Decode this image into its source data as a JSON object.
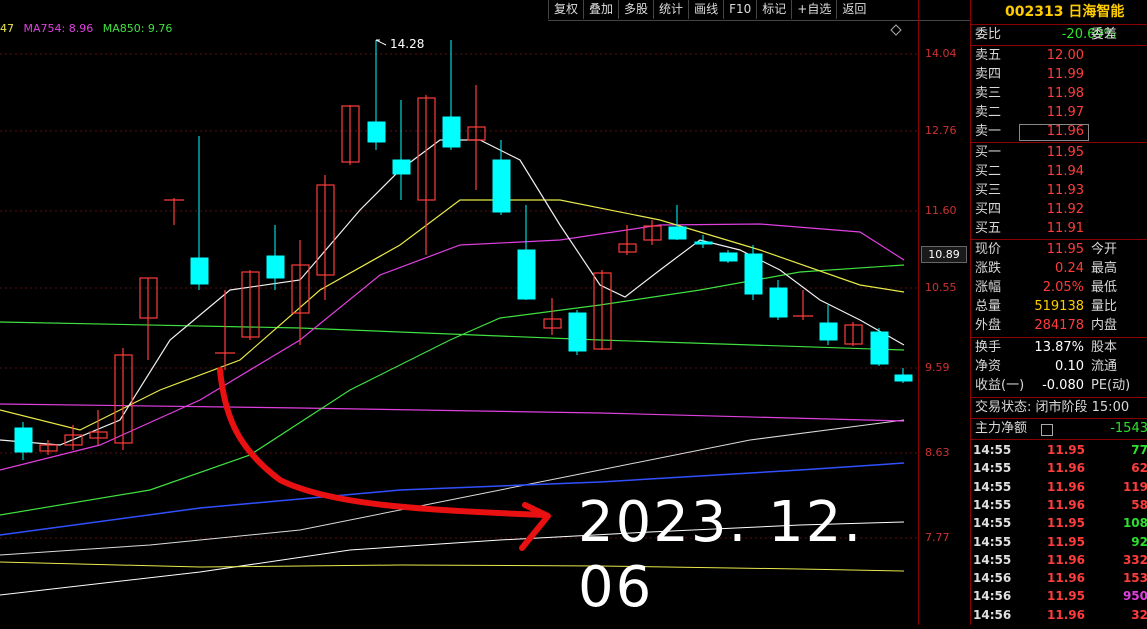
{
  "toolbar": [
    "复权",
    "叠加",
    "多股",
    "统计",
    "画线",
    "F10",
    "标记",
    "+自选",
    "返回"
  ],
  "ma_legend": [
    {
      "text": "47",
      "color": "#e8e84a"
    },
    {
      "text": "MA754: 8.96",
      "color": "#e040e0"
    },
    {
      "text": "MA850: 9.76",
      "color": "#40e040"
    }
  ],
  "price_axis": [
    "14.04",
    "12.76",
    "11.60",
    "10.55",
    "9.59",
    "8.63",
    "7.77"
  ],
  "current_price_tag": "10.89",
  "high_marker": "14.28",
  "annotation_date": "2023. 12. 06",
  "quote": {
    "code_name": "002313 日海智能",
    "weibi_label": "委比",
    "weibi_value": "-20.69%",
    "weicha_label": "委差",
    "asks": [
      {
        "label": "卖五",
        "price": "12.00"
      },
      {
        "label": "卖四",
        "price": "11.99"
      },
      {
        "label": "卖三",
        "price": "11.98"
      },
      {
        "label": "卖二",
        "price": "11.97"
      },
      {
        "label": "卖一",
        "price": "11.96"
      }
    ],
    "bids": [
      {
        "label": "买一",
        "price": "11.95"
      },
      {
        "label": "买二",
        "price": "11.94"
      },
      {
        "label": "买三",
        "price": "11.93"
      },
      {
        "label": "买四",
        "price": "11.92"
      },
      {
        "label": "买五",
        "price": "11.91"
      }
    ],
    "stats": [
      {
        "label": "现价",
        "value": "11.95",
        "label2": "今开",
        "color": "red"
      },
      {
        "label": "涨跌",
        "value": "0.24",
        "label2": "最高",
        "color": "red"
      },
      {
        "label": "涨幅",
        "value": "2.05%",
        "label2": "最低",
        "color": "red"
      },
      {
        "label": "总量",
        "value": "519138",
        "label2": "量比",
        "color": "white"
      },
      {
        "label": "外盘",
        "value": "284178",
        "label2": "内盘",
        "color": "red"
      }
    ],
    "stats2": [
      {
        "label": "换手",
        "value": "13.87%",
        "label2": "股本",
        "color": "white"
      },
      {
        "label": "净资",
        "value": "0.10",
        "label2": "流通",
        "color": "white"
      },
      {
        "label": "收益(一)",
        "value": "-0.080",
        "label2": "PE(动)",
        "color": "white"
      }
    ],
    "status_label": "交易状态: 闭市阶段 15:00",
    "main_net_label": "主力净额",
    "main_net_value": "-1543"
  },
  "trades": [
    {
      "time": "14:55",
      "price": "11.95",
      "vol": "77",
      "pc": "red",
      "vc": "green"
    },
    {
      "time": "14:55",
      "price": "11.96",
      "vol": "62",
      "pc": "red",
      "vc": "red"
    },
    {
      "time": "14:55",
      "price": "11.96",
      "vol": "119",
      "pc": "red",
      "vc": "red"
    },
    {
      "time": "14:55",
      "price": "11.96",
      "vol": "58",
      "pc": "red",
      "vc": "red"
    },
    {
      "time": "14:55",
      "price": "11.95",
      "vol": "108",
      "pc": "red",
      "vc": "green"
    },
    {
      "time": "14:55",
      "price": "11.95",
      "vol": "92",
      "pc": "red",
      "vc": "green"
    },
    {
      "time": "14:55",
      "price": "11.96",
      "vol": "332",
      "pc": "red",
      "vc": "red"
    },
    {
      "time": "14:56",
      "price": "11.96",
      "vol": "153",
      "pc": "red",
      "vc": "red"
    },
    {
      "time": "14:56",
      "price": "11.95",
      "vol": "950",
      "pc": "red",
      "vc": "magenta"
    },
    {
      "time": "14:56",
      "price": "11.96",
      "vol": "32",
      "pc": "red",
      "vc": "red"
    }
  ],
  "colors": {
    "up": "#ff3c3c",
    "down": "#00ffff",
    "axis": "#8b0000"
  }
}
